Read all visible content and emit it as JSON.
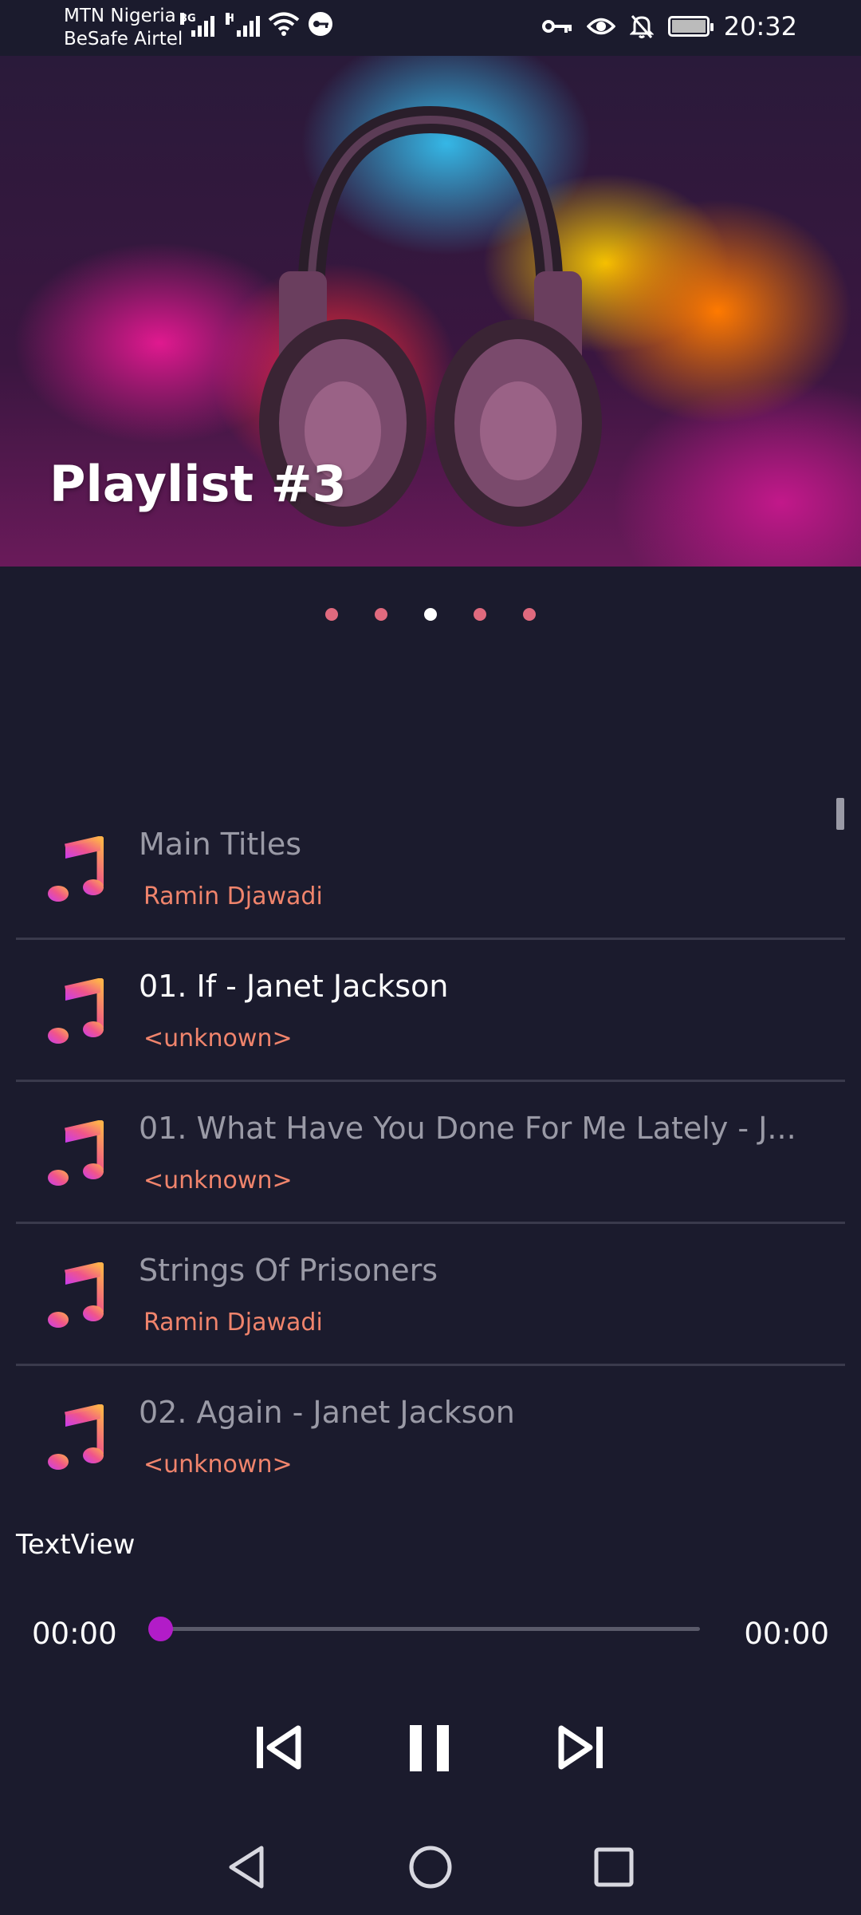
{
  "status_bar": {
    "carrier_1": "MTN Nigeria",
    "carrier_2": "BeSafe Airtel",
    "net_1": "3G",
    "net_2": "H",
    "time": "20:32"
  },
  "banner": {
    "title": "Playlist #3",
    "image_icon": "headphones-icon"
  },
  "carousel": {
    "pages": 5,
    "active_index": 2
  },
  "tracks": [
    {
      "title": "Main Titles",
      "artist": "Ramin Djawadi",
      "playing": false
    },
    {
      "title": "01. If - Janet Jackson",
      "artist": "<unknown>",
      "playing": true
    },
    {
      "title": "01. What Have You Done For Me Lately - J...",
      "artist": "<unknown>",
      "playing": false
    },
    {
      "title": "Strings Of Prisoners",
      "artist": "Ramin Djawadi",
      "playing": false
    },
    {
      "title": "02. Again - Janet Jackson",
      "artist": "<unknown>",
      "playing": false
    }
  ],
  "now_playing_label": "TextView",
  "player": {
    "elapsed": "00:00",
    "duration": "00:00",
    "progress": 0,
    "thumb_color": "#b21cc8"
  },
  "colors": {
    "background": "#1b1b2d",
    "artist_text": "#f0846c",
    "dot_color": "#e06a7e"
  }
}
